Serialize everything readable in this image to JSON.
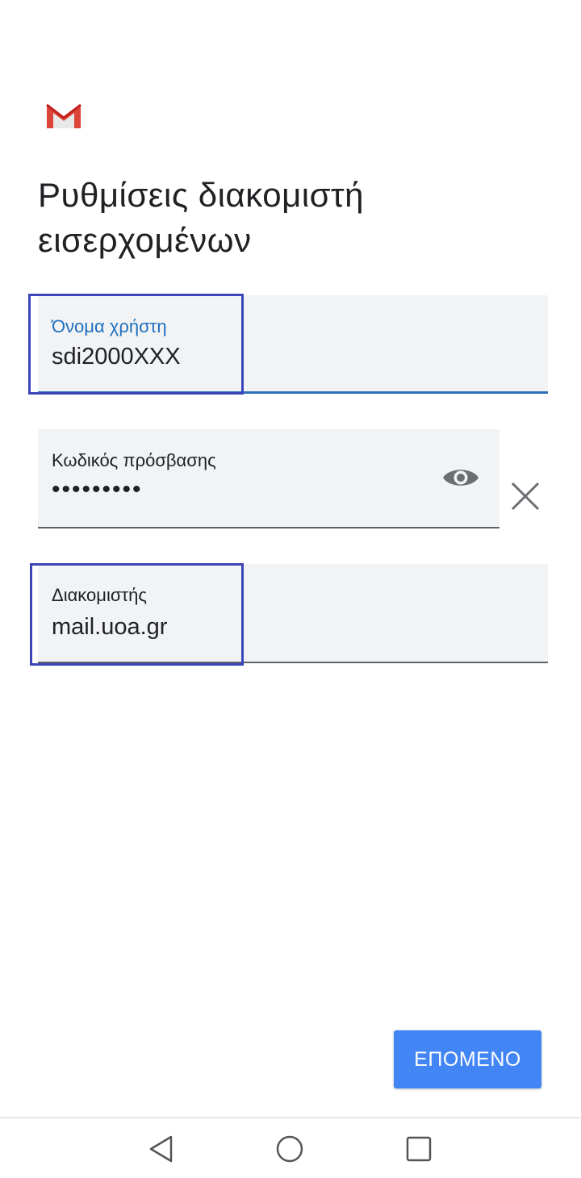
{
  "app": {
    "title": "Ρυθμίσεις διακομιστή εισερχομένων",
    "logo_icon": "gmail-logo-icon",
    "accent_color": "#4285f4",
    "highlight_color": "#3c44b9"
  },
  "form": {
    "username": {
      "label": "Όνομα χρήστη",
      "value": "sdi2000XXX"
    },
    "password": {
      "label": "Κωδικός πρόσβασης",
      "value": "•••••••••",
      "toggle_icon": "eye-icon",
      "clear_icon": "close-icon"
    },
    "server": {
      "label": "Διακομιστής",
      "value": "mail.uoa.gr"
    }
  },
  "actions": {
    "next_label": "ΕΠΟΜΕΝΟ"
  },
  "navigation": {
    "back_icon": "back-triangle-icon",
    "home_icon": "home-circle-icon",
    "recents_icon": "recents-square-icon"
  }
}
